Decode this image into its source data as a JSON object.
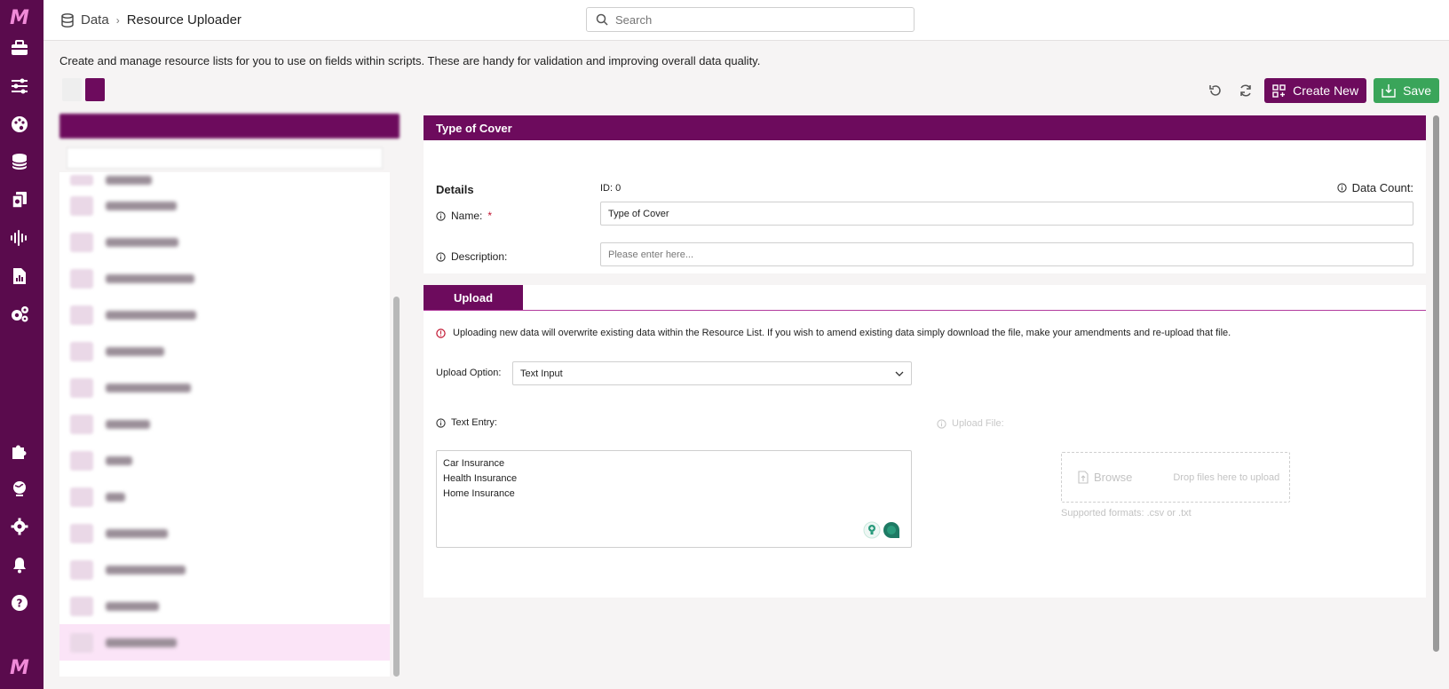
{
  "app": {
    "logo": "M"
  },
  "rail": {
    "icons": [
      "toolbox-icon",
      "sliders-icon",
      "palette-icon",
      "database-icon",
      "documents-icon",
      "audio-wave-icon",
      "report-icon",
      "cogs-icon",
      "puzzle-icon",
      "globe-icon",
      "settings-icon",
      "bell-icon",
      "help-icon"
    ]
  },
  "breadcrumb": {
    "root": "Data",
    "separator": "›",
    "current": "Resource Uploader"
  },
  "search": {
    "placeholder": "Search"
  },
  "intro": {
    "text": "Create and manage resource lists for you to use on fields within scripts. These are handy for validation and improving overall data quality."
  },
  "toolbar": {
    "create_label": "Create New",
    "save_label": "Save"
  },
  "colors": {
    "brand": "#6d0b5d",
    "rail": "#5a0b4d",
    "save": "#3aa55a",
    "selected_row": "#fbe4f7"
  },
  "details": {
    "header": "Type of Cover",
    "heading": "Details",
    "id_text": "ID: 0",
    "data_count_label": "Data Count:",
    "name_label": "Name:",
    "name_required": "*",
    "name_value": "Type of Cover",
    "description_label": "Description:",
    "description_placeholder": "Please enter here..."
  },
  "upload": {
    "tab_label": "Upload",
    "warning": "Uploading new data will overwrite existing data within the Resource List. If you wish to amend existing data simply download the file, make your amendments and re-upload that file.",
    "option_label": "Upload Option:",
    "option_value": "Text Input",
    "text_entry_label": "Text Entry:",
    "text_lines": [
      "Car Insurance",
      "Health Insurance",
      "Home Insurance"
    ],
    "upload_file_label": "Upload File:",
    "browse_label": "Browse",
    "drop_text": "Drop files here to upload",
    "formats": "Supported formats: .csv or .txt"
  }
}
